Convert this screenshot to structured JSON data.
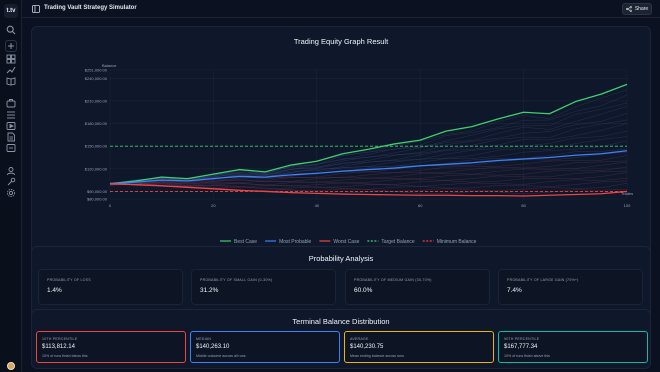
{
  "app": {
    "logo_text": "t.tv",
    "title": "Trading Vault Strategy Simulator",
    "share_label": "Share"
  },
  "sidebar": {
    "icons": [
      "search-icon",
      "add-icon",
      "library-icon",
      "trend-icon",
      "book-icon",
      "briefcase-icon",
      "list-icon",
      "media-icon",
      "document-icon",
      "message-icon",
      "users-icon",
      "wrench-icon",
      "settings-icon"
    ]
  },
  "chart": {
    "title": "Trading Equity Graph Result",
    "chart_data": {
      "type": "line",
      "title": "Trading Equity Graph Result",
      "xlabel": "Trades",
      "ylabel": "Balance",
      "xlim": [
        0,
        100
      ],
      "ylim": [
        80000,
        251000
      ],
      "x_ticks": [
        "0",
        "20",
        "40",
        "60",
        "80",
        "100"
      ],
      "y_ticks": [
        "$251,000.00",
        "$240,000.00",
        "$210,000.00",
        "$180,000.00",
        "$150,000.00",
        "$120,000.00",
        "$90,000.00",
        "$80,000.00"
      ],
      "x": [
        0,
        5,
        10,
        15,
        20,
        25,
        30,
        35,
        40,
        45,
        50,
        55,
        60,
        65,
        70,
        75,
        80,
        85,
        90,
        95,
        100
      ],
      "series": [
        {
          "name": "Best Case",
          "color": "#3ecf6e",
          "values": [
            100000,
            104000,
            109000,
            107000,
            113000,
            119000,
            116000,
            125000,
            130000,
            140000,
            146000,
            153000,
            158000,
            170000,
            176000,
            186000,
            195000,
            193000,
            209000,
            219000,
            232000
          ]
        },
        {
          "name": "Most Probable",
          "color": "#3b82f6",
          "values": [
            100000,
            102500,
            105000,
            104000,
            107000,
            110000,
            109000,
            112000,
            114000,
            117000,
            119000,
            121000,
            124000,
            126000,
            128000,
            131000,
            133000,
            135000,
            138000,
            140000,
            144000
          ]
        },
        {
          "name": "Worst Case",
          "color": "#ef4444",
          "values": [
            100000,
            99000,
            97500,
            95500,
            93500,
            91500,
            90000,
            88500,
            87500,
            86500,
            86000,
            85500,
            85000,
            85000,
            84500,
            84500,
            84000,
            85000,
            86000,
            87000,
            90000
          ]
        }
      ],
      "reference_lines": [
        {
          "name": "Target Balance",
          "color": "#3ecf6e",
          "value": 150000
        },
        {
          "name": "Minimum Balance",
          "color": "#ef4444",
          "value": 90000
        }
      ],
      "legend_position": "bottom",
      "grid": true
    }
  },
  "probability": {
    "title": "Probability Analysis",
    "stats": [
      {
        "label": "PROBABILITY OF LOSS",
        "value": "1.4%"
      },
      {
        "label": "PROBABILITY OF SMALL GAIN (0-30%)",
        "value": "31.2%"
      },
      {
        "label": "PROBABILITY OF MEDIUM GAIN (30-70%)",
        "value": "60.0%"
      },
      {
        "label": "PROBABILITY OF LARGE GAIN (70%+)",
        "value": "7.4%"
      }
    ]
  },
  "distribution": {
    "title": "Terminal Balance Distribution",
    "items": [
      {
        "label": "10TH PERCENTILE",
        "value": "$113,812.14",
        "desc": "10% of runs finish below this",
        "color": "#ef4444"
      },
      {
        "label": "MEDIAN",
        "value": "$140,263.10",
        "desc": "Middle outcome across all runs",
        "color": "#3b82f6"
      },
      {
        "label": "AVERAGE",
        "value": "$140,230.75",
        "desc": "Mean ending balance across runs",
        "color": "#eab308"
      },
      {
        "label": "90TH PERCENTILE",
        "value": "$167,777.34",
        "desc": "10% of runs finish above this",
        "color": "#14b8a6"
      }
    ]
  }
}
